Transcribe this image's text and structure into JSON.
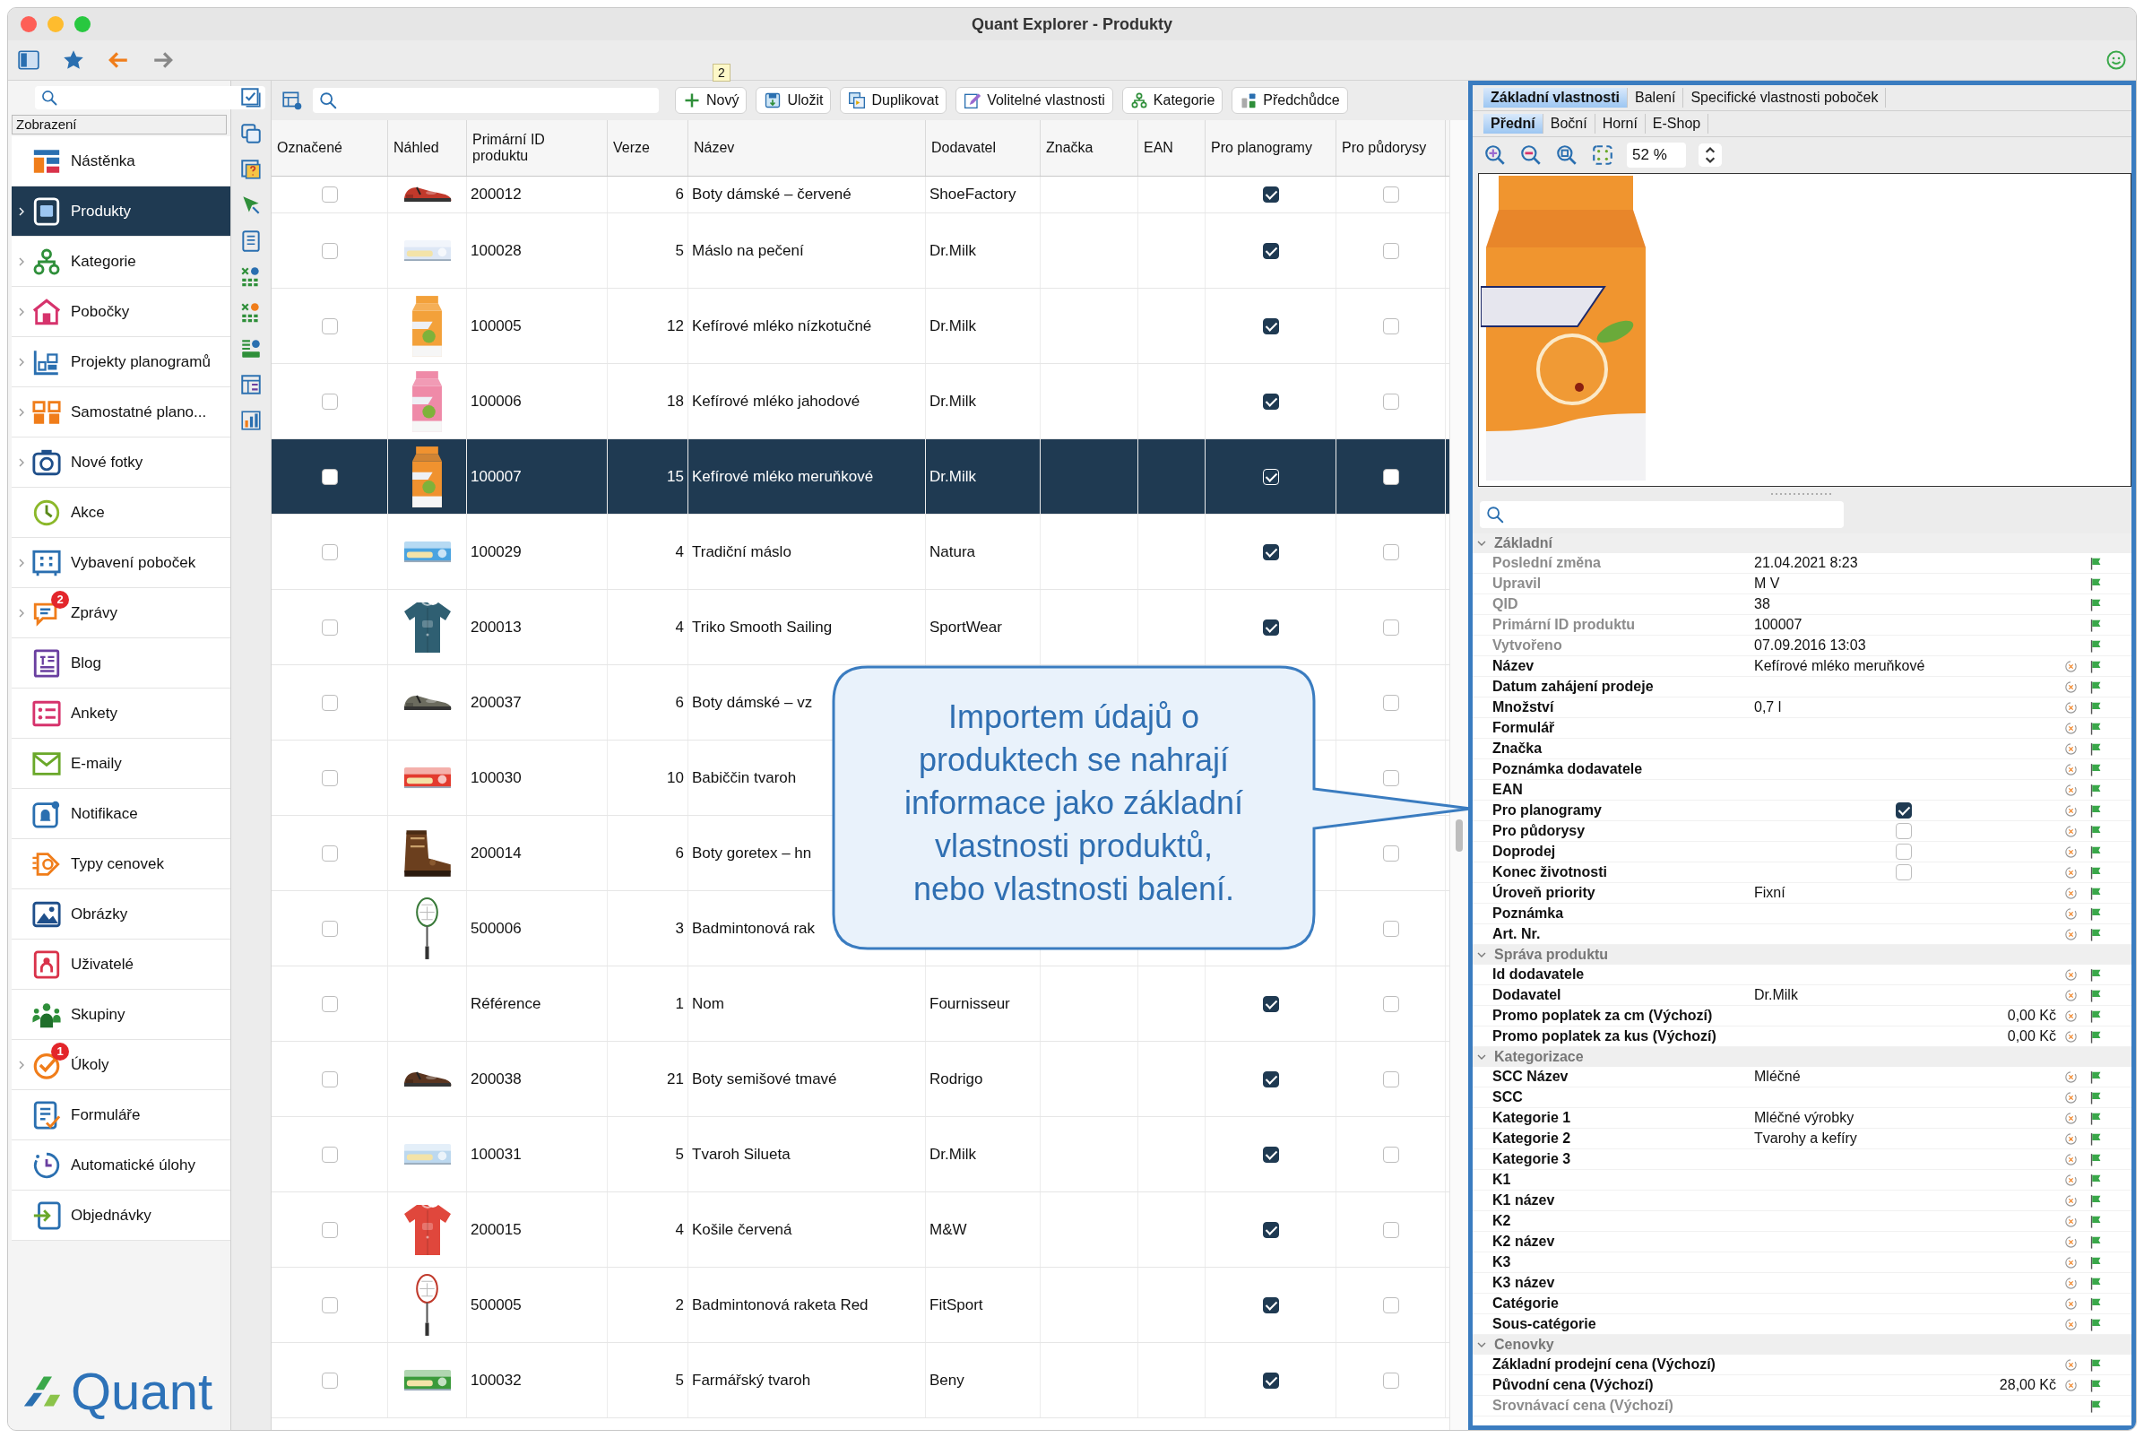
{
  "window": {
    "title": "Quant Explorer - Produkty"
  },
  "sidebar": {
    "header": "Zobrazení",
    "logo": "Quant",
    "items": [
      {
        "label": "Nástěnka",
        "selected": false,
        "expandable": false
      },
      {
        "label": "Produkty",
        "selected": true,
        "expandable": true
      },
      {
        "label": "Kategorie",
        "selected": false,
        "expandable": true
      },
      {
        "label": "Pobočky",
        "selected": false,
        "expandable": true
      },
      {
        "label": "Projekty planogramů",
        "selected": false,
        "expandable": true
      },
      {
        "label": "Samostatné plano...",
        "selected": false,
        "expandable": true
      },
      {
        "label": "Nové fotky",
        "selected": false,
        "expandable": true
      },
      {
        "label": "Akce",
        "selected": false,
        "expandable": false
      },
      {
        "label": "Vybavení poboček",
        "selected": false,
        "expandable": true
      },
      {
        "label": "Zprávy",
        "selected": false,
        "expandable": true,
        "badge": "2"
      },
      {
        "label": "Blog",
        "selected": false,
        "expandable": false
      },
      {
        "label": "Ankety",
        "selected": false,
        "expandable": false
      },
      {
        "label": "E-maily",
        "selected": false,
        "expandable": false
      },
      {
        "label": "Notifikace",
        "selected": false,
        "expandable": false
      },
      {
        "label": "Typy cenovek",
        "selected": false,
        "expandable": false
      },
      {
        "label": "Obrázky",
        "selected": false,
        "expandable": false
      },
      {
        "label": "Uživatelé",
        "selected": false,
        "expandable": false
      },
      {
        "label": "Skupiny",
        "selected": false,
        "expandable": false
      },
      {
        "label": "Úkoly",
        "selected": false,
        "expandable": true,
        "badge": "1"
      },
      {
        "label": "Formuláře",
        "selected": false,
        "expandable": false
      },
      {
        "label": "Automatické úlohy",
        "selected": false,
        "expandable": false
      },
      {
        "label": "Objednávky",
        "selected": false,
        "expandable": false
      }
    ]
  },
  "toolbar": {
    "tooltip": "2",
    "buttons": [
      "Nový",
      "Uložit",
      "Duplikovat",
      "Volitelné vlastnosti",
      "Kategorie",
      "Předchůdce"
    ]
  },
  "table": {
    "columns": [
      "Označené",
      "Náhled",
      "Primární ID produktu",
      "Verze",
      "Název",
      "Dodavatel",
      "Značka",
      "EAN",
      "Pro planogramy",
      "Pro půdorysy"
    ],
    "rows": [
      {
        "marked": false,
        "id": "200012",
        "version": "6",
        "name": "Boty dámské – červené",
        "supplier": "ShoeFactory",
        "planogram": true,
        "floorplan": false,
        "selected": false
      },
      {
        "marked": false,
        "id": "100028",
        "version": "5",
        "name": "Máslo na pečení",
        "supplier": "Dr.Milk",
        "planogram": true,
        "floorplan": false,
        "selected": false
      },
      {
        "marked": false,
        "id": "100005",
        "version": "12",
        "name": "Kefírové mléko nízkotučné",
        "supplier": "Dr.Milk",
        "planogram": true,
        "floorplan": false,
        "selected": false
      },
      {
        "marked": false,
        "id": "100006",
        "version": "18",
        "name": "Kefírové mléko jahodové",
        "supplier": "Dr.Milk",
        "planogram": true,
        "floorplan": false,
        "selected": false
      },
      {
        "marked": false,
        "id": "100007",
        "version": "15",
        "name": "Kefírové mléko meruňkové",
        "supplier": "Dr.Milk",
        "planogram": true,
        "floorplan": false,
        "selected": true
      },
      {
        "marked": false,
        "id": "100029",
        "version": "4",
        "name": "Tradiční máslo",
        "supplier": "Natura",
        "planogram": true,
        "floorplan": false,
        "selected": false
      },
      {
        "marked": false,
        "id": "200013",
        "version": "4",
        "name": "Triko Smooth Sailing",
        "supplier": "SportWear",
        "planogram": true,
        "floorplan": false,
        "selected": false
      },
      {
        "marked": false,
        "id": "200037",
        "version": "6",
        "name": "Boty dámské – vz",
        "floorplan": false,
        "selected": false
      },
      {
        "marked": false,
        "id": "100030",
        "version": "10",
        "name": "Babiččin tvaroh",
        "floorplan": false,
        "selected": false
      },
      {
        "marked": false,
        "id": "200014",
        "version": "6",
        "name": "Boty goretex – hn",
        "floorplan": false,
        "selected": false
      },
      {
        "marked": false,
        "id": "500006",
        "version": "3",
        "name": "Badmintonová rak",
        "floorplan": false,
        "selected": false
      },
      {
        "marked": false,
        "id": "Référence",
        "version": "1",
        "name": "Nom",
        "supplier": "Fournisseur",
        "planogram": true,
        "floorplan": false,
        "selected": false
      },
      {
        "marked": false,
        "id": "200038",
        "version": "21",
        "name": "Boty semišové tmavé",
        "supplier": "Rodrigo",
        "planogram": true,
        "floorplan": false,
        "selected": false
      },
      {
        "marked": false,
        "id": "100031",
        "version": "5",
        "name": "Tvaroh Silueta",
        "supplier": "Dr.Milk",
        "planogram": true,
        "floorplan": false,
        "selected": false
      },
      {
        "marked": false,
        "id": "200015",
        "version": "4",
        "name": "Košile červená",
        "supplier": "M&W",
        "planogram": true,
        "floorplan": false,
        "selected": false
      },
      {
        "marked": false,
        "id": "500005",
        "version": "2",
        "name": "Badmintonová raketa Red",
        "supplier": "FitSport",
        "planogram": true,
        "floorplan": false,
        "selected": false
      },
      {
        "marked": false,
        "id": "100032",
        "version": "5",
        "name": "Farmářský tvaroh",
        "supplier": "Beny",
        "planogram": true,
        "floorplan": false,
        "selected": false
      }
    ]
  },
  "callout": {
    "text": "Importem údajů o produktech se nahrají informace jako základní vlastnosti produktů, nebo vlastnosti balení."
  },
  "detail": {
    "tabs": [
      {
        "label": "Základní vlastnosti",
        "selected": true
      },
      {
        "label": "Balení",
        "selected": false
      },
      {
        "label": "Specifické vlastnosti poboček",
        "selected": false
      }
    ],
    "subtabs": [
      {
        "label": "Přední",
        "selected": true
      },
      {
        "label": "Boční",
        "selected": false
      },
      {
        "label": "Horní",
        "selected": false
      },
      {
        "label": "E-Shop",
        "selected": false
      }
    ],
    "zoom": "52 %",
    "groups": [
      {
        "title": "Základní",
        "expanded": true,
        "rows": [
          {
            "label": "Poslední změna",
            "value": "21.04.2021 8:23",
            "kind": "text",
            "readonly": true
          },
          {
            "label": "Upravil",
            "value": "M V",
            "kind": "text",
            "readonly": true
          },
          {
            "label": "QID",
            "value": "38",
            "kind": "text",
            "readonly": true
          },
          {
            "label": "Primární ID produktu",
            "value": "100007",
            "kind": "text",
            "readonly": true
          },
          {
            "label": "Vytvořeno",
            "value": "07.09.2016 13:03",
            "kind": "text",
            "readonly": true
          },
          {
            "label": "Název",
            "value": "Kefírové mléko meruňkové",
            "kind": "text",
            "readonly": false
          },
          {
            "label": "Datum zahájení prodeje",
            "kind": "text",
            "readonly": false
          },
          {
            "label": "Množství",
            "value": "0,7 l",
            "kind": "text",
            "readonly": false
          },
          {
            "label": "Formulář",
            "kind": "text",
            "readonly": false
          },
          {
            "label": "Značka",
            "kind": "text",
            "readonly": false
          },
          {
            "label": "Poznámka dodavatele",
            "kind": "text",
            "readonly": false
          },
          {
            "label": "EAN",
            "kind": "text",
            "readonly": false
          },
          {
            "label": "Pro planogramy",
            "kind": "checkbox",
            "checked": true,
            "readonly": false
          },
          {
            "label": "Pro půdorysy",
            "kind": "checkbox",
            "checked": false,
            "readonly": false
          },
          {
            "label": "Doprodej",
            "kind": "checkbox",
            "checked": false,
            "readonly": false
          },
          {
            "label": "Konec životnosti",
            "kind": "checkbox",
            "checked": false,
            "readonly": false
          },
          {
            "label": "Úroveň priority",
            "value": "Fixní",
            "kind": "text",
            "readonly": false
          },
          {
            "label": "Poznámka",
            "kind": "text",
            "readonly": false
          },
          {
            "label": "Art. Nr.",
            "kind": "text",
            "readonly": false
          }
        ]
      },
      {
        "title": "Správa produktu",
        "expanded": true,
        "rows": [
          {
            "label": "Id dodavatele",
            "kind": "text",
            "readonly": false
          },
          {
            "label": "Dodavatel",
            "value": "Dr.Milk",
            "kind": "text",
            "readonly": false
          },
          {
            "label": "Promo poplatek za cm (Výchozí)",
            "value": "0,00 Kč",
            "kind": "amount",
            "readonly": false
          },
          {
            "label": "Promo poplatek za kus (Výchozí)",
            "value": "0,00 Kč",
            "kind": "amount",
            "readonly": false
          }
        ]
      },
      {
        "title": "Kategorizace",
        "expanded": true,
        "rows": [
          {
            "label": "SCC Název",
            "value": "Mléčné",
            "kind": "text",
            "readonly": false
          },
          {
            "label": "SCC",
            "kind": "text",
            "readonly": false
          },
          {
            "label": "Kategorie 1",
            "value": "Mléčné výrobky",
            "kind": "text",
            "readonly": false
          },
          {
            "label": "Kategorie 2",
            "value": "Tvarohy a kefíry",
            "kind": "text",
            "readonly": false
          },
          {
            "label": "Kategorie 3",
            "kind": "text",
            "readonly": false
          },
          {
            "label": "K1",
            "kind": "text",
            "readonly": false
          },
          {
            "label": "K1 název",
            "kind": "text",
            "readonly": false
          },
          {
            "label": "K2",
            "kind": "text",
            "readonly": false
          },
          {
            "label": "K2 název",
            "kind": "text",
            "readonly": false
          },
          {
            "label": "K3",
            "kind": "text",
            "readonly": false
          },
          {
            "label": "K3 název",
            "kind": "text",
            "readonly": false
          },
          {
            "label": "Catégorie",
            "kind": "text",
            "readonly": false
          },
          {
            "label": "Sous-catégorie",
            "kind": "text",
            "readonly": false
          }
        ]
      },
      {
        "title": "Cenovky",
        "expanded": true,
        "rows": [
          {
            "label": "Základní prodejní cena (Výchozí)",
            "kind": "text",
            "readonly": false
          },
          {
            "label": "Původní cena (Výchozí)",
            "value": "28,00 Kč",
            "kind": "amount",
            "readonly": false
          },
          {
            "label": "Srovnávací cena (Výchozí)",
            "kind": "text",
            "readonly": true
          }
        ]
      }
    ]
  }
}
